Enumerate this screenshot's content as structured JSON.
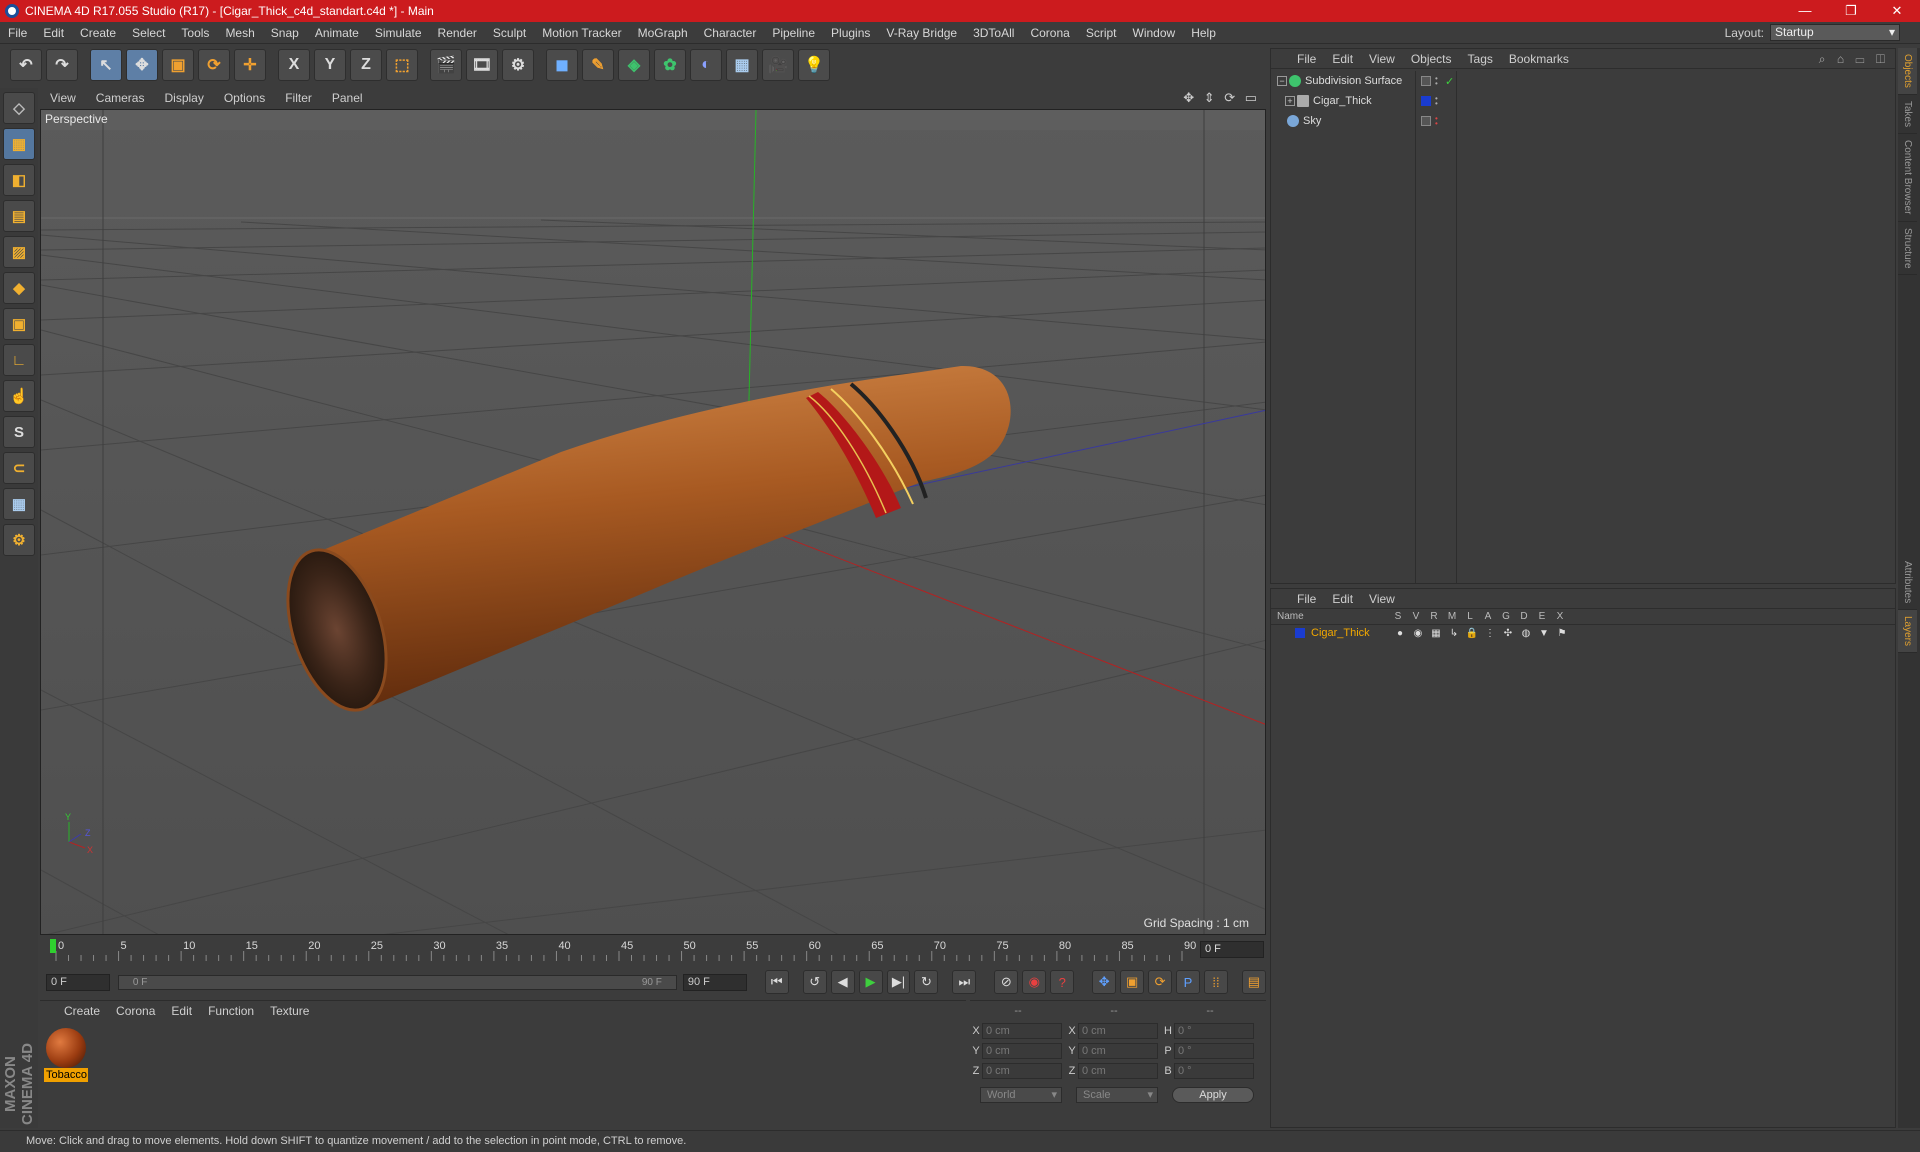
{
  "window": {
    "title": "CINEMA 4D R17.055 Studio (R17) - [Cigar_Thick_c4d_standart.c4d *] - Main",
    "minimize": "—",
    "restore": "❐",
    "close": "✕"
  },
  "menubar": {
    "items": [
      "File",
      "Edit",
      "Create",
      "Select",
      "Tools",
      "Mesh",
      "Snap",
      "Animate",
      "Simulate",
      "Render",
      "Sculpt",
      "Motion Tracker",
      "MoGraph",
      "Character",
      "Pipeline",
      "Plugins",
      "V-Ray Bridge",
      "3DToAll",
      "Corona",
      "Script",
      "Window",
      "Help"
    ],
    "layout_label": "Layout:",
    "layout_value": "Startup"
  },
  "toolbar": {
    "undo": "↶",
    "redo": "↷",
    "select": "↖",
    "move": "✥",
    "scale": "▣",
    "rotate": "⟳",
    "live": "✛",
    "x": "X",
    "y": "Y",
    "z": "Z",
    "coord": "⬚",
    "render_view": "🎬",
    "render_pic": "🎞",
    "render_settings": "⚙",
    "cube": "◼",
    "pen": "✎",
    "subdiv": "◈",
    "cloner": "✿",
    "deformer": "◐",
    "floor": "▦",
    "camera": "🎥",
    "light": "💡"
  },
  "left_tools": {
    "items": [
      "◇",
      "▦",
      "◧",
      "▤",
      "▨",
      "◆",
      "▣",
      "∟",
      "☝",
      "S",
      "⊂",
      "▦",
      "⚙"
    ]
  },
  "maxon_logo": "MAXON CINEMA 4D",
  "viewport": {
    "menu": [
      "View",
      "Cameras",
      "Display",
      "Options",
      "Filter",
      "Panel"
    ],
    "nav_icons": "✥ ⇕ ⟳ ▭",
    "label": "Perspective",
    "grid_spacing": "Grid Spacing : 1 cm",
    "axis_y": "Y",
    "axis_x": "X",
    "axis_z": "Z"
  },
  "timeline": {
    "ticks": [
      "0",
      "5",
      "10",
      "15",
      "20",
      "25",
      "30",
      "35",
      "40",
      "45",
      "50",
      "55",
      "60",
      "65",
      "70",
      "75",
      "80",
      "85",
      "90"
    ],
    "current_frame": "0 F"
  },
  "transport": {
    "start_field": "0 F",
    "slider_start": "0 F",
    "slider_end": "90 F",
    "end_field": "90 F",
    "buttons": [
      "⏮",
      "↺",
      "◀",
      "▶",
      "▶|",
      "↻",
      "⏭"
    ],
    "key_buttons": [
      "⊘",
      "◉",
      "?"
    ],
    "mode_buttons": [
      "✥",
      "▣",
      "⟳",
      "P",
      "⁞⁞",
      "▤"
    ]
  },
  "material_manager": {
    "menu": [
      "Create",
      "Corona",
      "Edit",
      "Function",
      "Texture"
    ],
    "material_name": "Tobacco"
  },
  "coordinates": {
    "headers": [
      "--",
      "--",
      "--"
    ],
    "rows": [
      {
        "a": "X",
        "v1": "0 cm",
        "b": "X",
        "v2": "0 cm",
        "c": "H",
        "v3": "0 °"
      },
      {
        "a": "Y",
        "v1": "0 cm",
        "b": "Y",
        "v2": "0 cm",
        "c": "P",
        "v3": "0 °"
      },
      {
        "a": "Z",
        "v1": "0 cm",
        "b": "Z",
        "v2": "0 cm",
        "c": "B",
        "v3": "0 °"
      }
    ],
    "world": "World",
    "scale": "Scale",
    "apply": "Apply"
  },
  "object_manager": {
    "menu": [
      "File",
      "Edit",
      "View",
      "Objects",
      "Tags",
      "Bookmarks"
    ],
    "icons": "⌕ ⌂ ▭ ◫",
    "objects": [
      {
        "name": "Subdivision Surface",
        "expander": "−",
        "color": "#3ec46d"
      },
      {
        "name": "Cigar_Thick",
        "expander": "+",
        "color": "#aaaaaa"
      },
      {
        "name": "Sky",
        "expander": "",
        "color": "#7aa7d8"
      }
    ]
  },
  "layer_manager": {
    "menu": [
      "File",
      "Edit",
      "View"
    ],
    "columns": [
      "Name",
      "S",
      "V",
      "R",
      "M",
      "L",
      "A",
      "G",
      "D",
      "E",
      "X"
    ],
    "layer_name": "Cigar_Thick",
    "layer_icons": [
      "●",
      "◉",
      "▦",
      "↳",
      "🔒",
      "⋮",
      "✣",
      "◍",
      "▼",
      "⚑"
    ]
  },
  "right_tabs": [
    "Objects",
    "Takes",
    "Content Browser",
    "Structure",
    "Attributes",
    "Layers"
  ],
  "status": "Move: Click and drag to move elements. Hold down SHIFT to quantize movement / add to the selection in point mode, CTRL to remove."
}
